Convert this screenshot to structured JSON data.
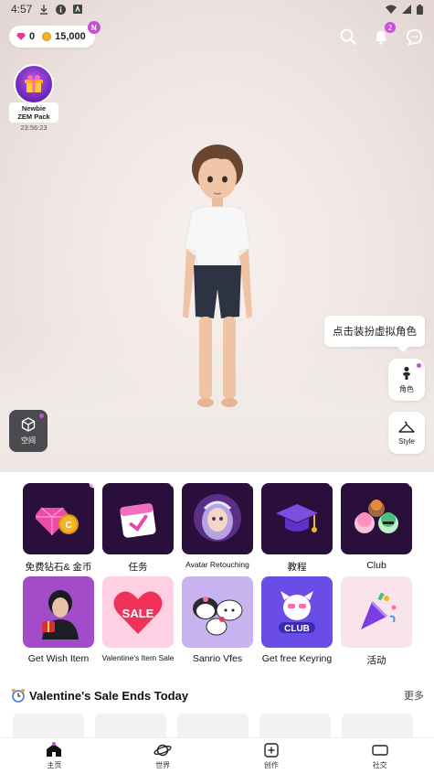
{
  "status_bar": {
    "time": "4:57"
  },
  "currency": {
    "gems": "0",
    "coins": "15,000",
    "badge": "N"
  },
  "notifications": {
    "count": "2"
  },
  "pack": {
    "label_line1": "Newbie",
    "label_line2": "ZEM Pack",
    "timer": "23:56:23"
  },
  "tooltip": "点击装扮虚拟角色",
  "side_buttons": {
    "character": "角色",
    "style": "Style"
  },
  "space_button": "空间",
  "tiles": [
    {
      "label": "免费钻石& 金币",
      "icon": "gem-coin-icon"
    },
    {
      "label": "任务",
      "icon": "calendar-icon"
    },
    {
      "label": "Avatar Retouching",
      "icon": "avatar-portrait-icon"
    },
    {
      "label": "教程",
      "icon": "graduation-cap-icon"
    },
    {
      "label": "Club",
      "icon": "club-friends-icon"
    },
    {
      "label": "Get Wish Item",
      "icon": "wish-item-icon"
    },
    {
      "label": "Valentine's Item Sale",
      "icon": "sale-heart-icon"
    },
    {
      "label": "Sanrio Vfes",
      "icon": "sanrio-characters-icon"
    },
    {
      "label": "Get free Keyring",
      "icon": "club-keyring-icon"
    },
    {
      "label": "活动",
      "icon": "party-popper-icon"
    }
  ],
  "sale": {
    "title": "Valentine's Sale Ends Today",
    "more": "更多"
  },
  "tabs": [
    {
      "label": "主页",
      "icon": "home-icon"
    },
    {
      "label": "世界",
      "icon": "planet-icon"
    },
    {
      "label": "创作",
      "icon": "create-plus-icon"
    },
    {
      "label": "社交",
      "icon": "social-icon"
    }
  ],
  "colors": {
    "accent": "#c84fd8",
    "dark_tile": "#2a0f3c",
    "gem": "#e23c9a",
    "coin": "#f3b32b"
  }
}
